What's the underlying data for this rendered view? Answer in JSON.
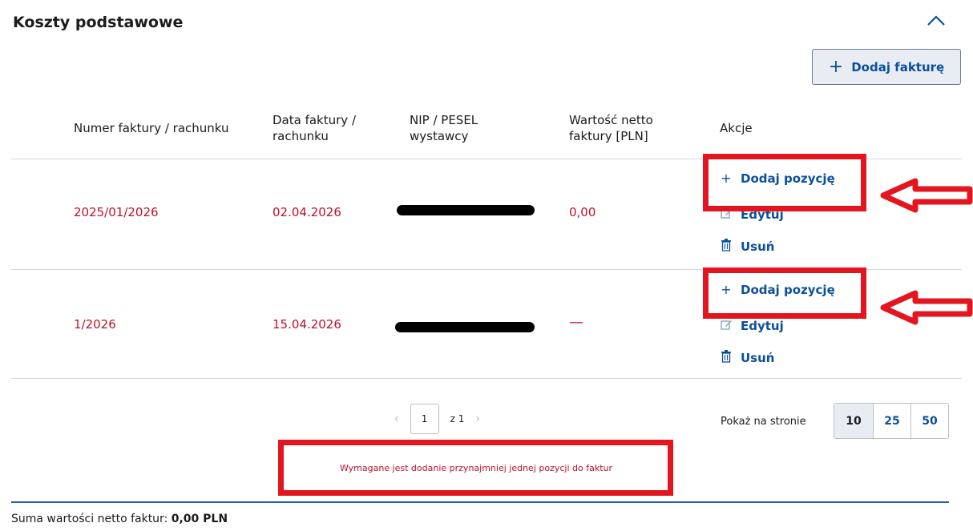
{
  "section": {
    "title": "Koszty podstawowe",
    "collapse_icon": "chevron-up-icon"
  },
  "toolbar": {
    "add_invoice_label": "Dodaj fakturę",
    "add_icon": "+"
  },
  "table": {
    "headers": {
      "number": "Numer faktury / rachunku",
      "date_l1": "Data faktury /",
      "date_l2": "rachunku",
      "nip_l1": "NIP / PESEL",
      "nip_l2": "wystawcy",
      "value_l1": "Wartość netto",
      "value_l2": "faktury [PLN]",
      "actions": "Akcje"
    },
    "rows": [
      {
        "number": "2025/01/2026",
        "date": "02.04.2026",
        "value": "0,00",
        "actions": {
          "add": "Dodaj pozycję",
          "edit": "Edytuj",
          "delete": "Usuń"
        }
      },
      {
        "number": "1/2026",
        "date": "15.04.2026",
        "value": "—",
        "actions": {
          "add": "Dodaj pozycję",
          "edit": "Edytuj",
          "delete": "Usuń"
        }
      }
    ]
  },
  "pagination": {
    "current_page": "1",
    "of_label": "z 1",
    "prev_icon": "‹",
    "next_icon": "›",
    "per_page_label": "Pokaż na stronie",
    "per_page_options": [
      "10",
      "25",
      "50"
    ],
    "per_page_selected": "10"
  },
  "validation": {
    "message": "Wymagane jest dodanie przynajmniej jednej pozycji do faktur"
  },
  "footer": {
    "sum_label": "Suma wartości netto faktur:",
    "sum_value": "0,00 PLN"
  },
  "colors": {
    "accent": "#0b4f9c",
    "error": "#c0102a",
    "annotation_red": "#e3161f"
  }
}
